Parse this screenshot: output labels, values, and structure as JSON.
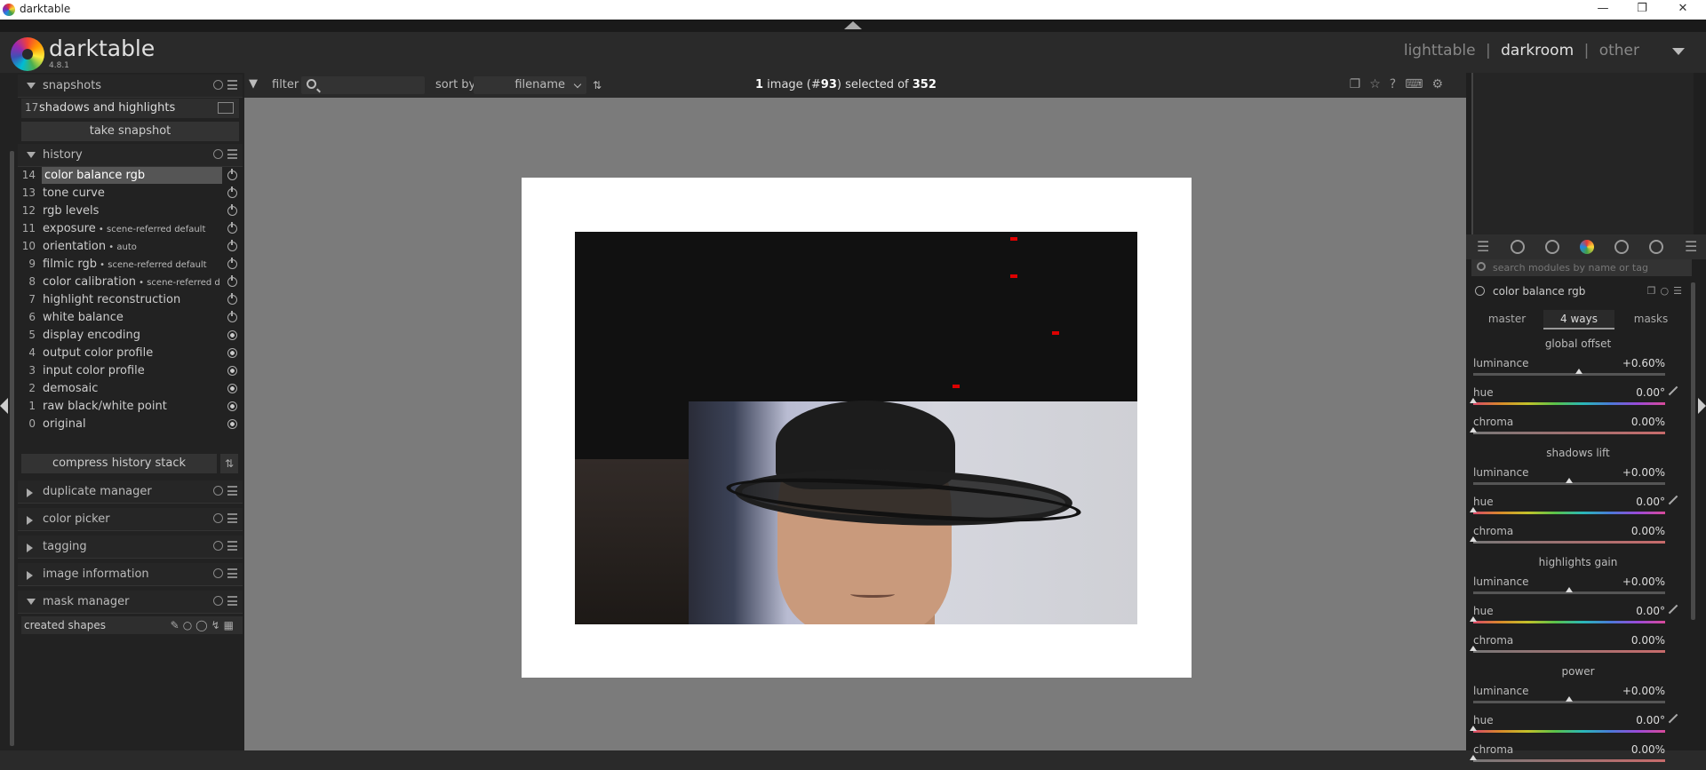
{
  "window": {
    "title": "darktable"
  },
  "app": {
    "name": "darktable",
    "version": "4.8.1"
  },
  "views": {
    "lighttable": "lighttable",
    "darkroom": "darkroom",
    "other": "other",
    "sep": "|"
  },
  "left": {
    "snapshots": {
      "title": "snapshots",
      "num": "17",
      "name": "shadows and highlights",
      "take": "take snapshot"
    },
    "history": {
      "title": "history",
      "items": [
        {
          "num": "14",
          "name": "color balance rgb",
          "extra": "",
          "state": "off"
        },
        {
          "num": "13",
          "name": "tone curve",
          "extra": "",
          "state": "off"
        },
        {
          "num": "12",
          "name": "rgb levels",
          "extra": "",
          "state": "off"
        },
        {
          "num": "11",
          "name": "exposure",
          "extra": " • scene-referred default",
          "state": "off"
        },
        {
          "num": "10",
          "name": "orientation",
          "extra": " • auto",
          "state": "off"
        },
        {
          "num": "9",
          "name": "filmic rgb",
          "extra": " • scene-referred default",
          "state": "off"
        },
        {
          "num": "8",
          "name": "color calibration",
          "extra": " • scene-referred defa...",
          "state": "off"
        },
        {
          "num": "7",
          "name": "highlight reconstruction",
          "extra": "",
          "state": "off"
        },
        {
          "num": "6",
          "name": "white balance",
          "extra": "",
          "state": "off"
        },
        {
          "num": "5",
          "name": "display encoding",
          "extra": "",
          "state": "on"
        },
        {
          "num": "4",
          "name": "output color profile",
          "extra": "",
          "state": "on"
        },
        {
          "num": "3",
          "name": "input color profile",
          "extra": "",
          "state": "on"
        },
        {
          "num": "2",
          "name": "demosaic",
          "extra": "",
          "state": "on"
        },
        {
          "num": "1",
          "name": "raw black/white point",
          "extra": "",
          "state": "on"
        },
        {
          "num": "0",
          "name": "original",
          "extra": "",
          "state": "on"
        }
      ],
      "compress": "compress history stack"
    },
    "duplicate": "duplicate manager",
    "colorpicker": "color picker",
    "tagging": "tagging",
    "imageinfo": "image information",
    "maskmanager": "mask manager",
    "createdshapes": "created shapes"
  },
  "filterbar": {
    "filter": "filter",
    "search_placeholder": "",
    "sortby": "sort by",
    "sortval": "filename"
  },
  "selection": {
    "count": "1",
    "pre": " image (#",
    "id": "93",
    "mid": ") selected of ",
    "total": "352"
  },
  "right": {
    "search_placeholder": "search modules by name or tag",
    "module": "color balance rgb",
    "tabs": [
      "master",
      "4 ways",
      "masks"
    ],
    "sections": [
      {
        "title": "global offset",
        "rows": [
          {
            "label": "luminance",
            "value": "+0.60%",
            "type": "lum",
            "pos": 0.55,
            "pick": false
          },
          {
            "label": "hue",
            "value": "0.00°",
            "type": "hue",
            "pos": 0.0,
            "pick": true
          },
          {
            "label": "chroma",
            "value": "0.00%",
            "type": "chroma",
            "pos": 0.0,
            "pick": false
          }
        ]
      },
      {
        "title": "shadows lift",
        "rows": [
          {
            "label": "luminance",
            "value": "+0.00%",
            "type": "lum",
            "pos": 0.5,
            "pick": false
          },
          {
            "label": "hue",
            "value": "0.00°",
            "type": "hue",
            "pos": 0.0,
            "pick": true
          },
          {
            "label": "chroma",
            "value": "0.00%",
            "type": "chroma",
            "pos": 0.0,
            "pick": false
          }
        ]
      },
      {
        "title": "highlights gain",
        "rows": [
          {
            "label": "luminance",
            "value": "+0.00%",
            "type": "lum",
            "pos": 0.5,
            "pick": false
          },
          {
            "label": "hue",
            "value": "0.00°",
            "type": "hue",
            "pos": 0.0,
            "pick": true
          },
          {
            "label": "chroma",
            "value": "0.00%",
            "type": "chroma",
            "pos": 0.0,
            "pick": false
          }
        ]
      },
      {
        "title": "power",
        "rows": [
          {
            "label": "luminance",
            "value": "+0.00%",
            "type": "lum",
            "pos": 0.5,
            "pick": false
          },
          {
            "label": "hue",
            "value": "0.00°",
            "type": "hue",
            "pos": 0.0,
            "pick": true
          },
          {
            "label": "chroma",
            "value": "0.00%",
            "type": "chroma",
            "pos": 0.0,
            "pick": false
          }
        ]
      }
    ]
  }
}
